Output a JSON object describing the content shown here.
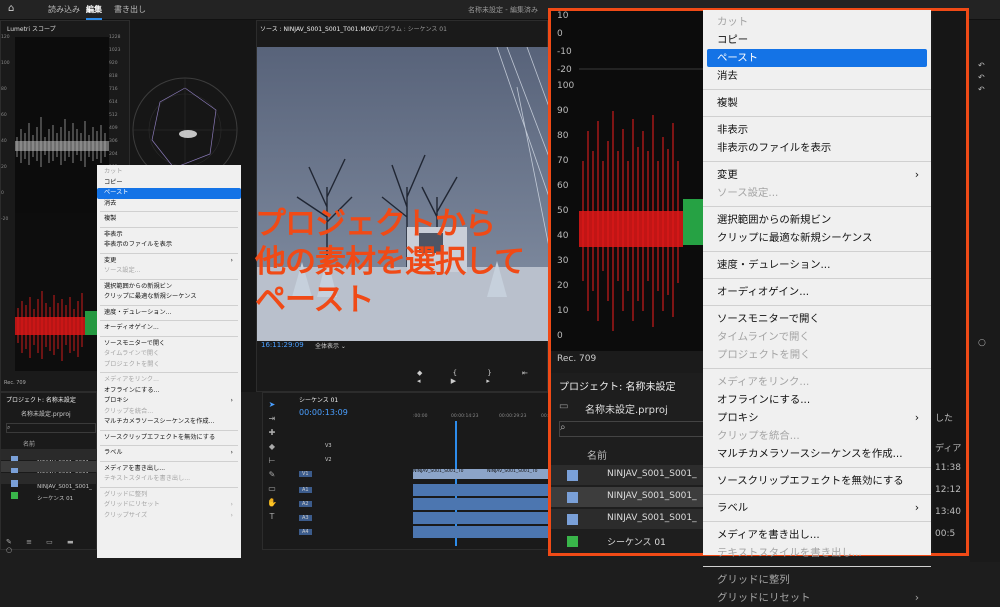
{
  "topbar": {
    "tabs": [
      "読み込み",
      "編集",
      "書き出し"
    ],
    "active_tab": "編集",
    "doc_title": "名称未設定 - 編集済み"
  },
  "lumetri": {
    "title": "Lumetri スコープ",
    "left_ticks": [
      "120",
      "100",
      "80",
      "60",
      "40",
      "20",
      "0",
      "-20"
    ],
    "right_ticks": [
      "1228",
      "1023",
      "920",
      "818",
      "716",
      "614",
      "512",
      "409",
      "306",
      "204",
      "102",
      "0"
    ],
    "lower_ticks": [
      "100",
      "90",
      "80",
      "70",
      "60",
      "50",
      "40",
      "30",
      "20",
      "10",
      "0"
    ],
    "rec": "Rec. 709"
  },
  "source_monitor": {
    "tab": "ソース : NINJAV_S001_S001_T001.MOV",
    "program_tab": "プログラム : シーケンス 01",
    "timecode": "16:11:29:09",
    "fit": "全体表示"
  },
  "timeline": {
    "tab": "シーケンス 01",
    "timecode": "00:00:13:09",
    "ruler": [
      ":00:00",
      "00:00:14:23",
      "00:00:29:23",
      "00:00:44:22"
    ],
    "video_tracks": [
      "V3",
      "V2",
      "V1"
    ],
    "audio_tracks": [
      "A1",
      "A2",
      "A3",
      "A4"
    ],
    "clip_label": "NINJAV_S001_S001_T0",
    "clip_label2": "NINJAV_S001_S001_T0"
  },
  "project_small": {
    "title": "プロジェクト: 名称未設定",
    "file": "名称未設定.prproj",
    "col_name": "名前",
    "items": [
      {
        "name": "NINJAV_S001_S001_",
        "color": "#7aa0d8"
      },
      {
        "name": "NINJAV_S001_S001_",
        "color": "#7aa0d8"
      },
      {
        "name": "NINJAV_S001_S001_",
        "color": "#7aa0d8"
      },
      {
        "name": "シーケンス 01",
        "color": "#39b54a"
      }
    ]
  },
  "context_menu": {
    "groups": [
      [
        {
          "label": "カット",
          "disabled": true
        },
        {
          "label": "コピー"
        },
        {
          "label": "ペースト",
          "selected": true
        },
        {
          "label": "消去"
        }
      ],
      [
        {
          "label": "複製"
        }
      ],
      [
        {
          "label": "非表示"
        },
        {
          "label": "非表示のファイルを表示"
        }
      ],
      [
        {
          "label": "変更",
          "submenu": true
        },
        {
          "label": "ソース設定...",
          "disabled": true
        }
      ],
      [
        {
          "label": "選択範囲からの新規ビン"
        },
        {
          "label": "クリップに最適な新規シーケンス"
        }
      ],
      [
        {
          "label": "速度・デュレーション..."
        }
      ],
      [
        {
          "label": "オーディオゲイン..."
        }
      ],
      [
        {
          "label": "ソースモニターで開く"
        },
        {
          "label": "タイムラインで開く",
          "disabled": true
        },
        {
          "label": "プロジェクトを開く",
          "disabled": true
        }
      ],
      [
        {
          "label": "メディアをリンク...",
          "disabled": true
        },
        {
          "label": "オフラインにする..."
        },
        {
          "label": "プロキシ",
          "submenu": true
        },
        {
          "label": "クリップを統合...",
          "disabled": true
        },
        {
          "label": "マルチカメラソースシーケンスを作成..."
        }
      ],
      [
        {
          "label": "ソースクリップエフェクトを無効にする"
        }
      ],
      [
        {
          "label": "ラベル",
          "submenu": true
        }
      ],
      [
        {
          "label": "メディアを書き出し..."
        },
        {
          "label": "テキストスタイルを書き出し...",
          "disabled": true
        }
      ],
      [
        {
          "label": "グリッドに整列",
          "disabled": true
        },
        {
          "label": "グリッドにリセット",
          "disabled": true,
          "submenu": true
        },
        {
          "label": "クリップサイズ",
          "disabled": true,
          "submenu": true
        }
      ]
    ],
    "big_visible_count": 27
  },
  "callout": {
    "lines": [
      "プロジェクトから",
      "他の素材を選択して",
      "ペースト"
    ],
    "color": "#f04a16"
  },
  "zoom": {
    "scope_ticks_top": [
      "10",
      "0",
      "-10",
      "-20"
    ],
    "scope_ticks": [
      "100",
      "90",
      "80",
      "70",
      "60",
      "50",
      "40",
      "30",
      "20",
      "10",
      "0"
    ],
    "rec": "Rec. 709",
    "project_title": "プロジェクト: 名称未設定",
    "file": "名称未設定.prproj",
    "col_name": "名前",
    "right_partial": [
      "した",
      "ディア",
      "11:38",
      "12:12",
      "13:40",
      "00:5"
    ]
  },
  "colors": {
    "accent": "#1473e6",
    "callout": "#f04a16",
    "panel_bg": "#1a1a1a"
  }
}
